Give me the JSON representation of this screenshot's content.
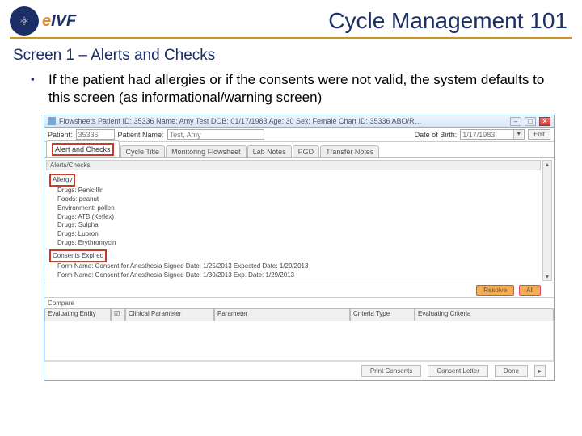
{
  "header": {
    "logo_e": "e",
    "logo_rest": "IVF",
    "title": "Cycle Management 101"
  },
  "subhead": "Screen 1 – Alerts and Checks",
  "bullet": "If the patient had allergies or if the consents were not valid, the system defaults to this screen (as informational/warning screen)",
  "win": {
    "title": "Flowsheets   Patient ID: 35336   Name: Amy Test   DOB: 01/17/1983   Age: 30   Sex: Female   Chart ID: 35336   ABO/R…",
    "min": "–",
    "max": "□",
    "close": "✕"
  },
  "toprow": {
    "patient_label": "Patient:",
    "patient_id": "35336",
    "name_label": "Patient Name:",
    "name_val": "Test, Amy",
    "dob_label": "Date of Birth:",
    "dob_val": "1/17/1983",
    "add": "Edit"
  },
  "tabs": [
    "Alert and Checks",
    "Cycle Title",
    "Monitoring Flowsheet",
    "Lab Notes",
    "PGD",
    "Transfer Notes"
  ],
  "panel": {
    "head": "Alerts/Checks",
    "allergy_head": "Allergy",
    "items": [
      "Drugs: Penicillin",
      "Foods: peanut",
      "Environment: pollen",
      "Drugs: ATB (Keflex)",
      "Drugs: Sulpha",
      "Drugs: Lupron",
      "Drugs: Erythromycin"
    ],
    "consent_head": "Consents Expired",
    "consents": [
      "Form Name: Consent for Anesthesia  Signed Date: 1/25/2013  Expected Date: 1/29/2013",
      "Form Name: Consent for Anesthesia  Signed Date: 1/30/2013  Exp. Date: 1/29/2013"
    ]
  },
  "btns": {
    "resolve": "Resolve",
    "all": "All"
  },
  "compare": "Compare",
  "grid": {
    "cols": [
      "Evaluating Entity",
      "☑",
      "Clinical Parameter",
      "Parameter",
      "Criteria Type",
      "Evaluating Criteria"
    ]
  },
  "bottom": {
    "print": "Print Consents",
    "corr": "Consent Letter",
    "done": "Done",
    "arrow": "▸"
  }
}
